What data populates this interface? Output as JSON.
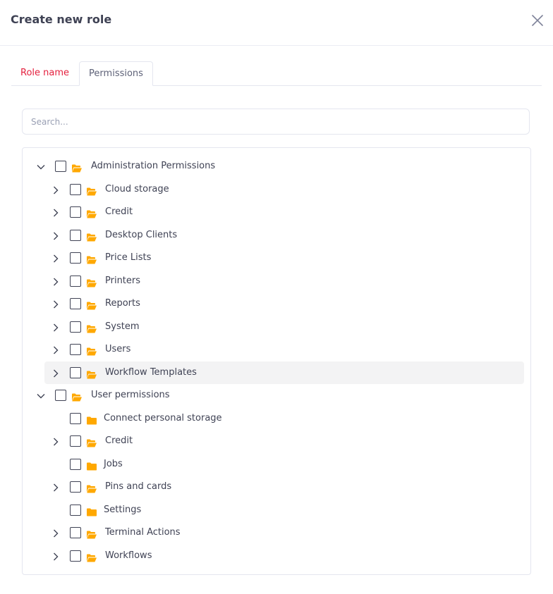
{
  "dialog": {
    "title": "Create new role",
    "tabs": {
      "role_name": "Role name",
      "permissions": "Permissions"
    },
    "search_placeholder": "Search..."
  },
  "tree": {
    "admin": {
      "label": "Administration Permissions",
      "items": [
        "Cloud storage",
        "Credit",
        "Desktop Clients",
        "Price Lists",
        "Printers",
        "Reports",
        "System",
        "Users",
        "Workflow Templates"
      ]
    },
    "user": {
      "label": "User permissions",
      "items": [
        "Connect personal storage",
        "Credit",
        "Jobs",
        "Pins and cards",
        "Settings",
        "Terminal Actions",
        "Workflows"
      ]
    }
  },
  "colors": {
    "folder": "#ffa800",
    "accent_tab": "#e4203e",
    "highlight": "#f3f3f4"
  }
}
